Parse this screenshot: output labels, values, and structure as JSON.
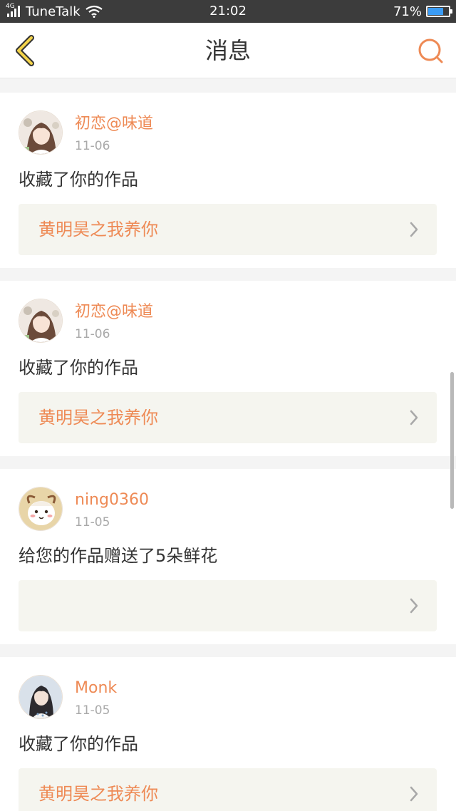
{
  "status_bar": {
    "network_type": "4G",
    "carrier": "TuneTalk",
    "time": "21:02",
    "battery_percent": "71%",
    "battery_level": 0.71
  },
  "header": {
    "title": "消息",
    "back_icon": "chevron-left-icon",
    "search_icon": "search-icon",
    "accent_color": "#ee8a55"
  },
  "messages": [
    {
      "username": "初恋@味道",
      "date": "11-06",
      "text": "收藏了你的作品",
      "work_title": "黄明昊之我养你",
      "avatar": "girl-photo"
    },
    {
      "username": "初恋@味道",
      "date": "11-06",
      "text": "收藏了你的作品",
      "work_title": "黄明昊之我养你",
      "avatar": "girl-photo"
    },
    {
      "username": "ning0360",
      "date": "11-05",
      "text": "给您的作品赠送了5朵鲜花",
      "work_title": "",
      "avatar": "sheep-cartoon"
    },
    {
      "username": "Monk",
      "date": "11-05",
      "text": "收藏了你的作品",
      "work_title": "黄明昊之我养你",
      "avatar": "girl-photo"
    }
  ]
}
